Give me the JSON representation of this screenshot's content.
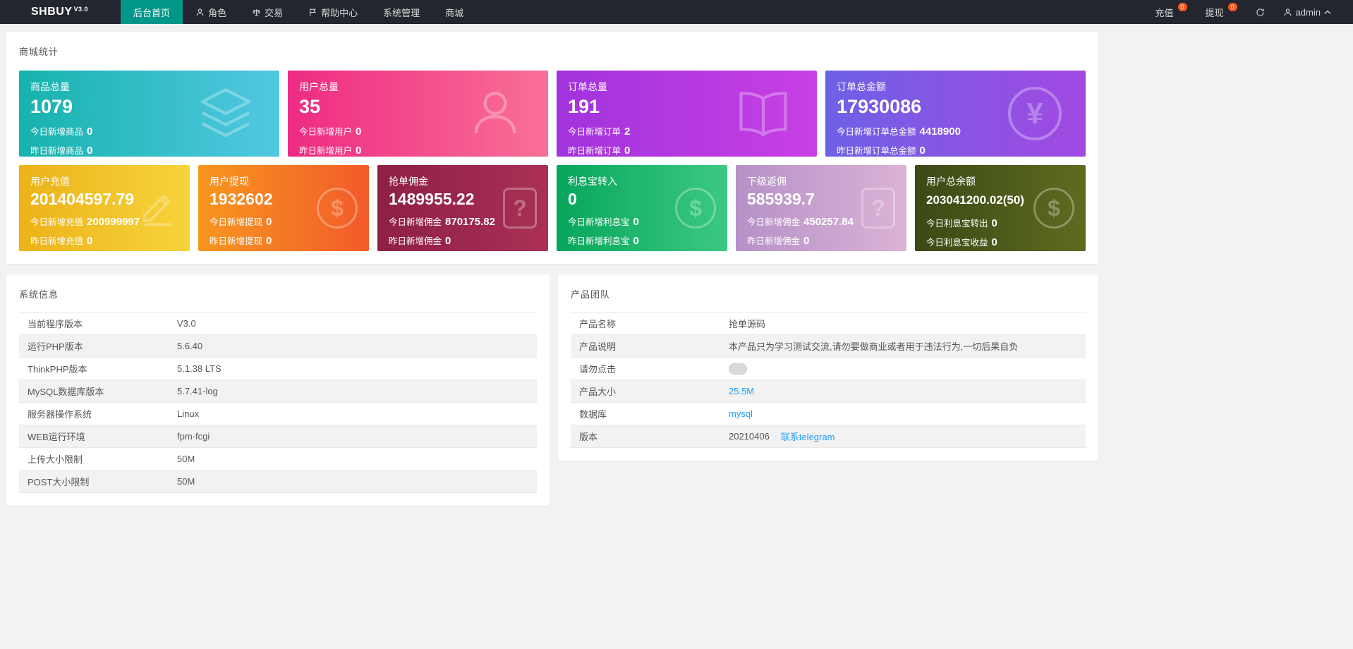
{
  "navbar": {
    "logo": "SHBUY",
    "logo_version": "V3.0",
    "items": [
      {
        "label": "后台首页",
        "active": true
      },
      {
        "label": "角色"
      },
      {
        "label": "交易"
      },
      {
        "label": "帮助中心"
      },
      {
        "label": "系统管理"
      },
      {
        "label": "商城"
      }
    ],
    "recharge_label": "充值",
    "recharge_badge": "0",
    "withdraw_label": "提现",
    "withdraw_badge": "0",
    "admin_label": "admin",
    "active_color": "#009688",
    "badge_color": "#ff5722",
    "bar_color": "#23262e"
  },
  "stats": {
    "section_title": "商城统计",
    "big_cards": [
      {
        "title": "商品总量",
        "value": "1079",
        "line2_label": "今日新增商品",
        "line2_value": "0",
        "line3_label": "昨日新增商品",
        "line3_value": "0",
        "icon": "layers-icon",
        "gradient": [
          "#17b3ad",
          "#51c8e2"
        ]
      },
      {
        "title": "用户总量",
        "value": "35",
        "line2_label": "今日新增用户",
        "line2_value": "0",
        "line3_label": "昨日新增用户",
        "line3_value": "0",
        "icon": "user-icon",
        "gradient": [
          "#ee2b83",
          "#f97096"
        ]
      },
      {
        "title": "订单总量",
        "value": "191",
        "line2_label": "今日新增订单",
        "line2_value": "2",
        "line3_label": "昨日新增订单",
        "line3_value": "0",
        "icon": "book-icon",
        "gradient": [
          "#a233dd",
          "#c840e4"
        ]
      },
      {
        "title": "订单总金额",
        "value": "17930086",
        "line2_label": "今日新增订单总金额",
        "line2_value": "4418900",
        "line3_label": "昨日新增订单总金额",
        "line3_value": "0",
        "icon": "yen-icon",
        "gradient": [
          "#6e61e6",
          "#a149e2"
        ]
      }
    ],
    "small_cards": [
      {
        "title": "用户充值",
        "value": "201404597.79",
        "line2_label": "今日新增充值",
        "line2_value": "200999997",
        "line3_label": "昨日新增充值",
        "line3_value": "0",
        "icon": "pencil-icon",
        "gradient": [
          "#ecb219",
          "#f7d43c"
        ]
      },
      {
        "title": "用户提现",
        "value": "1932602",
        "line2_label": "今日新增提现",
        "line2_value": "0",
        "line3_label": "昨日新增提现",
        "line3_value": "0",
        "icon": "dollar-icon",
        "gradient": [
          "#f8961e",
          "#f25b2a"
        ]
      },
      {
        "title": "抢单佣金",
        "value": "1489955.22",
        "line2_label": "今日新增佣金",
        "line2_value": "870175.82",
        "line3_label": "昨日新增佣金",
        "line3_value": "0",
        "icon": "question-icon",
        "gradient": [
          "#8d1f47",
          "#aa3055"
        ]
      },
      {
        "title": "利息宝转入",
        "value": "0",
        "line2_label": "今日新增利息宝",
        "line2_value": "0",
        "line3_label": "昨日新增利息宝",
        "line3_value": "0",
        "icon": "dollar-icon",
        "gradient": [
          "#07a65c",
          "#3cc981"
        ]
      },
      {
        "title": "下级返佣",
        "value": "585939.7",
        "line2_label": "今日新增佣金",
        "line2_value": "450257.84",
        "line3_label": "昨日新增佣金",
        "line3_value": "0",
        "icon": "question-icon",
        "gradient": [
          "#b691c8",
          "#dbb3d6"
        ]
      },
      {
        "title": "用户总余额",
        "value": "203041200.02(50)",
        "line2_label": "今日利息宝转出",
        "line2_value": "0",
        "line3_label": "今日利息宝收益",
        "line3_value": "0",
        "icon": "dollar-icon",
        "gradient": [
          "#3b4915",
          "#5e6b20"
        ]
      }
    ]
  },
  "system_info": {
    "title": "系统信息",
    "rows": [
      {
        "label": "当前程序版本",
        "value": "V3.0"
      },
      {
        "label": "运行PHP版本",
        "value": "5.6.40"
      },
      {
        "label": "ThinkPHP版本",
        "value": "5.1.38 LTS"
      },
      {
        "label": "MySQL数据库版本",
        "value": "5.7.41-log"
      },
      {
        "label": "服务器操作系统",
        "value": "Linux"
      },
      {
        "label": "WEB运行环境",
        "value": "fpm-fcgi"
      },
      {
        "label": "上传大小限制",
        "value": "50M"
      },
      {
        "label": "POST大小限制",
        "value": "50M"
      }
    ]
  },
  "product_team": {
    "title": "产品团队",
    "rows": {
      "name": {
        "label": "产品名称",
        "value": "抢单源码"
      },
      "desc": {
        "label": "产品说明",
        "value": "本产品只为学习测试交流,请勿要做商业或者用于违法行为,一切后果自负"
      },
      "noclick": {
        "label": "请勿点击"
      },
      "size": {
        "label": "产品大小",
        "value": "25.5M"
      },
      "db": {
        "label": "数据库",
        "value": "mysql"
      },
      "version": {
        "label": "版本",
        "value": "20210406",
        "link": "联系telegram"
      }
    },
    "link_color": "#1e9fff"
  }
}
